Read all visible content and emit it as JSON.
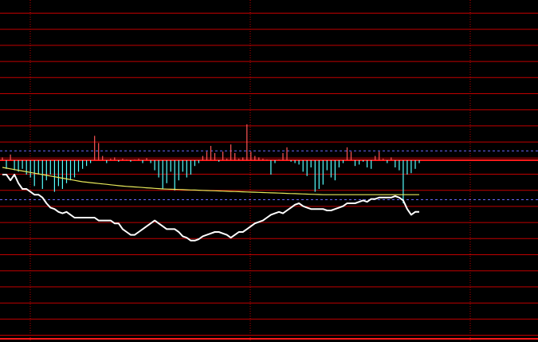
{
  "colors": {
    "background": "#000000",
    "grid": "#c00000",
    "zero_line": "#ff1a1a",
    "dashed_ref": "#6a6aff",
    "bar_positive": "#ff5555",
    "bar_negative": "#55ffff",
    "line_white": "#ffffff",
    "line_yellow": "#e8e85a"
  },
  "chart_data": {
    "type": "bar",
    "grid": true,
    "ylim": [
      -1.26,
      1.0
    ],
    "zero_level": 0,
    "upper_ref": 0.065,
    "lower_ref": -0.275,
    "x": [
      1,
      2,
      3,
      4,
      5,
      6,
      7,
      8,
      9,
      10,
      11,
      12,
      13,
      14,
      15,
      16,
      17,
      18,
      19,
      20,
      21,
      22,
      23,
      24,
      25,
      26,
      27,
      28,
      29,
      30,
      31,
      32,
      33,
      34,
      35,
      36,
      37,
      38,
      39,
      40,
      41,
      42,
      43,
      44,
      45,
      46,
      47,
      48,
      49,
      50,
      51,
      52,
      53,
      54,
      55,
      56,
      57,
      58,
      59,
      60,
      61,
      62,
      63,
      64,
      65,
      66,
      67,
      68,
      69,
      70,
      71,
      72,
      73,
      74,
      75,
      76,
      77,
      78,
      79,
      80,
      81,
      82,
      83,
      84,
      85,
      86,
      87,
      88,
      89,
      90,
      91,
      92,
      93,
      94,
      95,
      96,
      97,
      98,
      99,
      100,
      101,
      102,
      103,
      104,
      105
    ],
    "series": [
      {
        "style": "bars",
        "values": [
          0.02,
          -0.06,
          0.04,
          -0.07,
          -0.08,
          -0.06,
          -0.1,
          -0.12,
          -0.18,
          -0.1,
          -0.2,
          -0.14,
          -0.1,
          -0.22,
          -0.18,
          -0.2,
          -0.16,
          -0.14,
          -0.12,
          -0.08,
          -0.06,
          -0.04,
          -0.02,
          0.17,
          0.12,
          0.03,
          -0.02,
          0.01,
          0.02,
          -0.01,
          0.01,
          0.005,
          -0.01,
          0.005,
          0.01,
          -0.02,
          0.015,
          -0.02,
          -0.07,
          -0.12,
          -0.2,
          -0.16,
          -0.08,
          -0.21,
          -0.14,
          -0.08,
          -0.12,
          -0.1,
          -0.04,
          -0.02,
          0.03,
          0.06,
          0.1,
          0.05,
          -0.01,
          0.06,
          0.01,
          0.11,
          0.05,
          0.01,
          0.02,
          0.25,
          0.06,
          0.03,
          0.02,
          0.01,
          0.005,
          -0.1,
          -0.02,
          0.005,
          0.05,
          0.09,
          -0.01,
          -0.02,
          -0.03,
          -0.08,
          -0.11,
          -0.05,
          -0.22,
          -0.2,
          -0.17,
          -0.07,
          -0.12,
          -0.14,
          -0.05,
          -0.02,
          0.09,
          0.06,
          -0.04,
          -0.03,
          -0.01,
          -0.05,
          -0.06,
          0.03,
          0.06,
          0.01,
          -0.02,
          0.02,
          -0.05,
          -0.07,
          -0.3,
          -0.1,
          -0.09,
          -0.06,
          -0.02
        ]
      },
      {
        "style": "line",
        "color": "line_yellow",
        "values": [
          -0.05,
          -0.055,
          -0.06,
          -0.065,
          -0.07,
          -0.075,
          -0.08,
          -0.085,
          -0.09,
          -0.095,
          -0.1,
          -0.105,
          -0.11,
          -0.115,
          -0.12,
          -0.125,
          -0.13,
          -0.135,
          -0.14,
          -0.145,
          -0.15,
          -0.153,
          -0.156,
          -0.159,
          -0.162,
          -0.165,
          -0.168,
          -0.171,
          -0.174,
          -0.177,
          -0.18,
          -0.182,
          -0.184,
          -0.186,
          -0.188,
          -0.19,
          -0.192,
          -0.194,
          -0.196,
          -0.198,
          -0.2,
          -0.201,
          -0.202,
          -0.203,
          -0.204,
          -0.205,
          -0.206,
          -0.207,
          -0.208,
          -0.209,
          -0.21,
          -0.211,
          -0.212,
          -0.213,
          -0.214,
          -0.215,
          -0.216,
          -0.217,
          -0.218,
          -0.219,
          -0.22,
          -0.221,
          -0.222,
          -0.223,
          -0.224,
          -0.225,
          -0.226,
          -0.227,
          -0.228,
          -0.229,
          -0.23,
          -0.231,
          -0.232,
          -0.233,
          -0.234,
          -0.235,
          -0.236,
          -0.237,
          -0.238,
          -0.239,
          -0.24,
          -0.24,
          -0.24,
          -0.24,
          -0.24,
          -0.24,
          -0.24,
          -0.24,
          -0.24,
          -0.24,
          -0.24,
          -0.24,
          -0.24,
          -0.24,
          -0.24,
          -0.24,
          -0.24,
          -0.24,
          -0.24,
          -0.24,
          -0.24,
          -0.24,
          -0.24,
          -0.24,
          -0.24
        ]
      },
      {
        "style": "line",
        "color": "line_white",
        "values": [
          -0.1,
          -0.1,
          -0.14,
          -0.1,
          -0.16,
          -0.2,
          -0.2,
          -0.22,
          -0.24,
          -0.24,
          -0.26,
          -0.3,
          -0.33,
          -0.34,
          -0.36,
          -0.37,
          -0.36,
          -0.38,
          -0.4,
          -0.4,
          -0.4,
          -0.4,
          -0.4,
          -0.4,
          -0.42,
          -0.42,
          -0.42,
          -0.42,
          -0.44,
          -0.44,
          -0.48,
          -0.5,
          -0.52,
          -0.52,
          -0.5,
          -0.48,
          -0.46,
          -0.44,
          -0.42,
          -0.44,
          -0.46,
          -0.48,
          -0.48,
          -0.48,
          -0.5,
          -0.53,
          -0.54,
          -0.56,
          -0.56,
          -0.55,
          -0.53,
          -0.52,
          -0.51,
          -0.5,
          -0.5,
          -0.51,
          -0.52,
          -0.54,
          -0.52,
          -0.5,
          -0.5,
          -0.48,
          -0.46,
          -0.44,
          -0.43,
          -0.42,
          -0.4,
          -0.38,
          -0.37,
          -0.36,
          -0.37,
          -0.35,
          -0.33,
          -0.31,
          -0.3,
          -0.32,
          -0.33,
          -0.34,
          -0.34,
          -0.34,
          -0.34,
          -0.35,
          -0.35,
          -0.34,
          -0.33,
          -0.32,
          -0.3,
          -0.3,
          -0.3,
          -0.29,
          -0.28,
          -0.29,
          -0.27,
          -0.27,
          -0.26,
          -0.26,
          -0.26,
          -0.26,
          -0.25,
          -0.26,
          -0.28,
          -0.34,
          -0.38,
          -0.36,
          -0.36
        ]
      }
    ]
  }
}
